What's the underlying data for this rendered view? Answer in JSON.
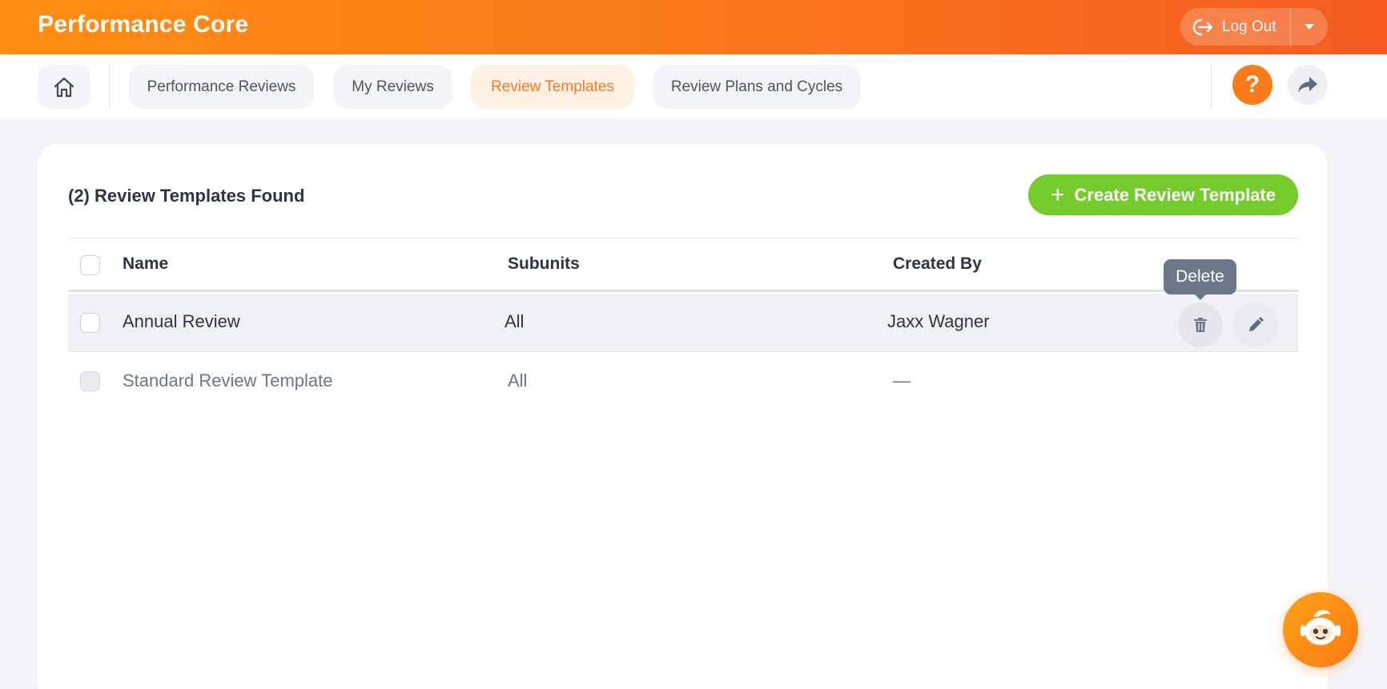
{
  "app": {
    "title": "Performance Core"
  },
  "header": {
    "logout_label": "Log Out"
  },
  "nav": {
    "tabs": [
      {
        "label": "Performance Reviews",
        "active": false
      },
      {
        "label": "My Reviews",
        "active": false
      },
      {
        "label": "Review Templates",
        "active": true
      },
      {
        "label": "Review Plans and Cycles",
        "active": false
      }
    ],
    "help_symbol": "?"
  },
  "main": {
    "found_title": "(2) Review Templates Found",
    "create_button_label": "Create Review Template",
    "columns": {
      "name": "Name",
      "subunits": "Subunits",
      "created_by": "Created By"
    },
    "rows": [
      {
        "name": "Annual Review",
        "subunits": "All",
        "created_by": "Jaxx Wagner"
      },
      {
        "name": "Standard Review Template",
        "subunits": "All",
        "created_by": "—"
      }
    ],
    "tooltip": "Delete"
  },
  "colors": {
    "brand_orange": "#fb7a1a",
    "create_green": "#76cb2c",
    "active_tab_text": "#f77a22",
    "active_tab_bg": "#fef0e3"
  },
  "icons": [
    "logout-icon",
    "chevron-down-icon",
    "home-icon",
    "help-icon",
    "share-icon",
    "plus-icon",
    "trash-icon",
    "pencil-icon",
    "robot-assistant-icon"
  ]
}
